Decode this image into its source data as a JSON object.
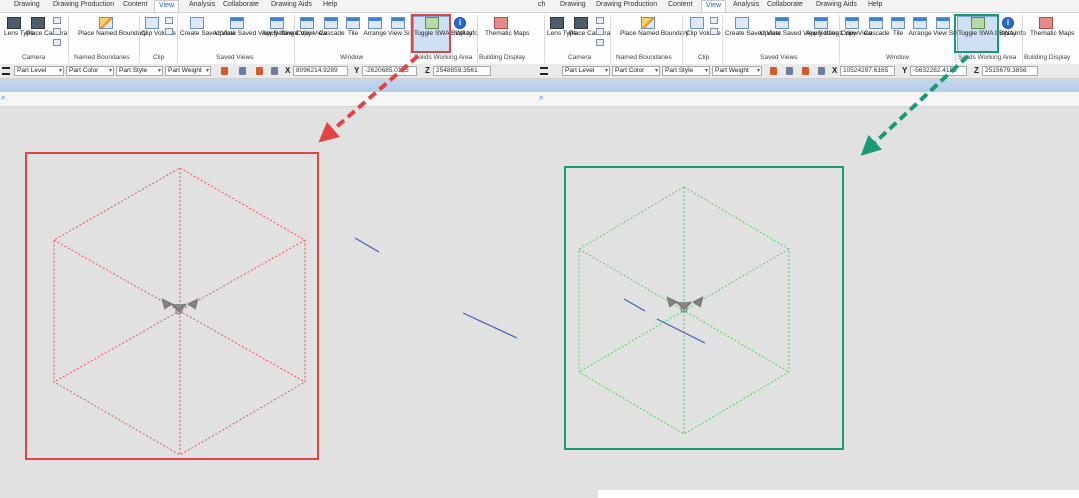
{
  "tabs_left": [
    "Drawing",
    "Drawing Production",
    "Content",
    "View",
    "Analysis",
    "Collaborate",
    "Drawing Aids",
    "Help"
  ],
  "tabs_right": [
    "ch",
    "Drawing",
    "Drawing Production",
    "Content",
    "View",
    "Analysis",
    "Collaborate",
    "Drawing Aids",
    "Help"
  ],
  "active_tab": "View",
  "ribbon": {
    "lens_type": "Lens Type",
    "place_camera": "Place Camera",
    "camera_group": "Camera",
    "place_named_boundary": "Place Named Boundary",
    "named_boundaries_group": "Named Boundaries",
    "clip_volume": "Clip Volume",
    "clip_group": "Clip",
    "create_saved_view": "Create Saved View",
    "update_saved_view_settings": "Update Saved View Settings",
    "apply_saved_view": "Apply Saved View",
    "saved_views_group": "Saved Views",
    "copy_view": "Copy View",
    "cascade": "Cascade",
    "tile": "Tile",
    "arrange": "Arrange",
    "view_size": "View Size",
    "window_group": "Window",
    "toggle_swa_display": "Toggle SWA Display",
    "swa_info": "SWA Info",
    "solids_working_area_group": "Solids Working Area",
    "thematic_maps": "Thematic Maps",
    "building_display_group": "Building Display"
  },
  "attributes": {
    "part_level": "Part Level",
    "part_color": "Part Color",
    "part_style": "Part Style",
    "part_weight": "Part Weight"
  },
  "coords_left": {
    "x_label": "X",
    "x": "8096214.9289",
    "y_label": "Y",
    "y": "-2620685.0125",
    "z_label": "Z",
    "z": "2548859.3561"
  },
  "coords_right": {
    "x_label": "X",
    "x": "10524297.6165",
    "y_label": "Y",
    "y": "-5632282.4185",
    "z_label": "Z",
    "z": "2515679.3856"
  },
  "colors": {
    "highlight_left": "#e04545",
    "highlight_right": "#1a9a74",
    "cube_left": "#e8555a",
    "cube_right": "#4fd25a",
    "line": "#3a62b6"
  }
}
